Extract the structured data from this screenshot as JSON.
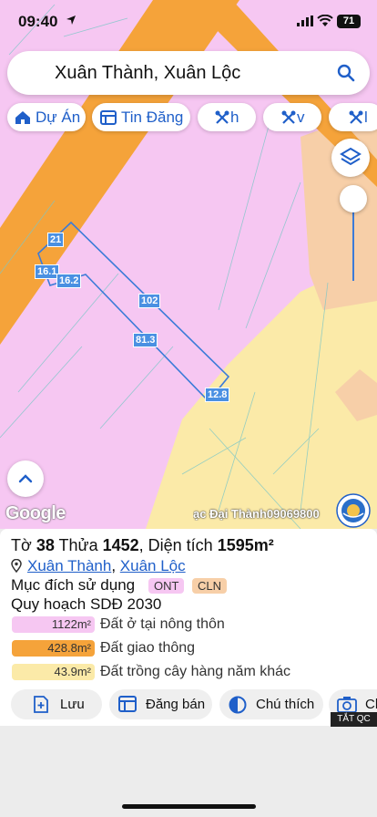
{
  "status": {
    "time": "09:40",
    "battery": "71"
  },
  "search": {
    "query": "Xuân Thành, Xuân Lộc"
  },
  "chips": [
    {
      "label": "Dự Án",
      "icon": "home-icon"
    },
    {
      "label": "Tin Đăng",
      "icon": "listing-icon"
    },
    {
      "label": "h",
      "icon": "tools-icon"
    },
    {
      "label": "v",
      "icon": "tools-icon"
    },
    {
      "label": "l",
      "icon": "tools-icon"
    }
  ],
  "map": {
    "google": "Google",
    "watermark": "ạc Đại Thành09069800",
    "dimensions": [
      "21",
      "16.1",
      "16.2",
      "102",
      "81.3",
      "12.8"
    ]
  },
  "panel": {
    "title_prefix": "Tờ ",
    "sheet": "38",
    "title_mid": " Thửa ",
    "parcel": "1452",
    "title_area_label": ", Diện tích ",
    "area": "1595m²",
    "commune": "Xuân Thành",
    "separator": ", ",
    "district": "Xuân Lộc",
    "purpose_label": "Mục đích sử dụng",
    "purpose_tags": [
      {
        "code": "ONT",
        "color": "#f6c7f2"
      },
      {
        "code": "CLN",
        "color": "#f7cfa8"
      }
    ],
    "plan_label": "Quy hoạch SDĐ 2030",
    "land_uses": [
      {
        "area": "1122m²",
        "name": "Đất ở tại nông thôn",
        "color": "#f6c7f2"
      },
      {
        "area": "428.8m²",
        "name": "Đất giao thông",
        "color": "#f5a33a"
      },
      {
        "area": "43.9m²",
        "name": "Đất trồng cây hàng năm khác",
        "color": "#fbeaa8"
      }
    ],
    "actions": [
      {
        "label": "Lưu",
        "icon": "save-add-icon"
      },
      {
        "label": "Đăng bán",
        "icon": "listing-icon"
      },
      {
        "label": "Chú thích",
        "icon": "legend-icon"
      },
      {
        "label": "Ch",
        "icon": "camera-icon"
      }
    ],
    "ad_label": "TẮT QC"
  },
  "colors": {
    "residential": "#f6c7f2",
    "road": "#f5a33a",
    "annual_crop": "#fbeaa8",
    "perennial": "#f7cfa8",
    "accent": "#1f5fc9"
  }
}
